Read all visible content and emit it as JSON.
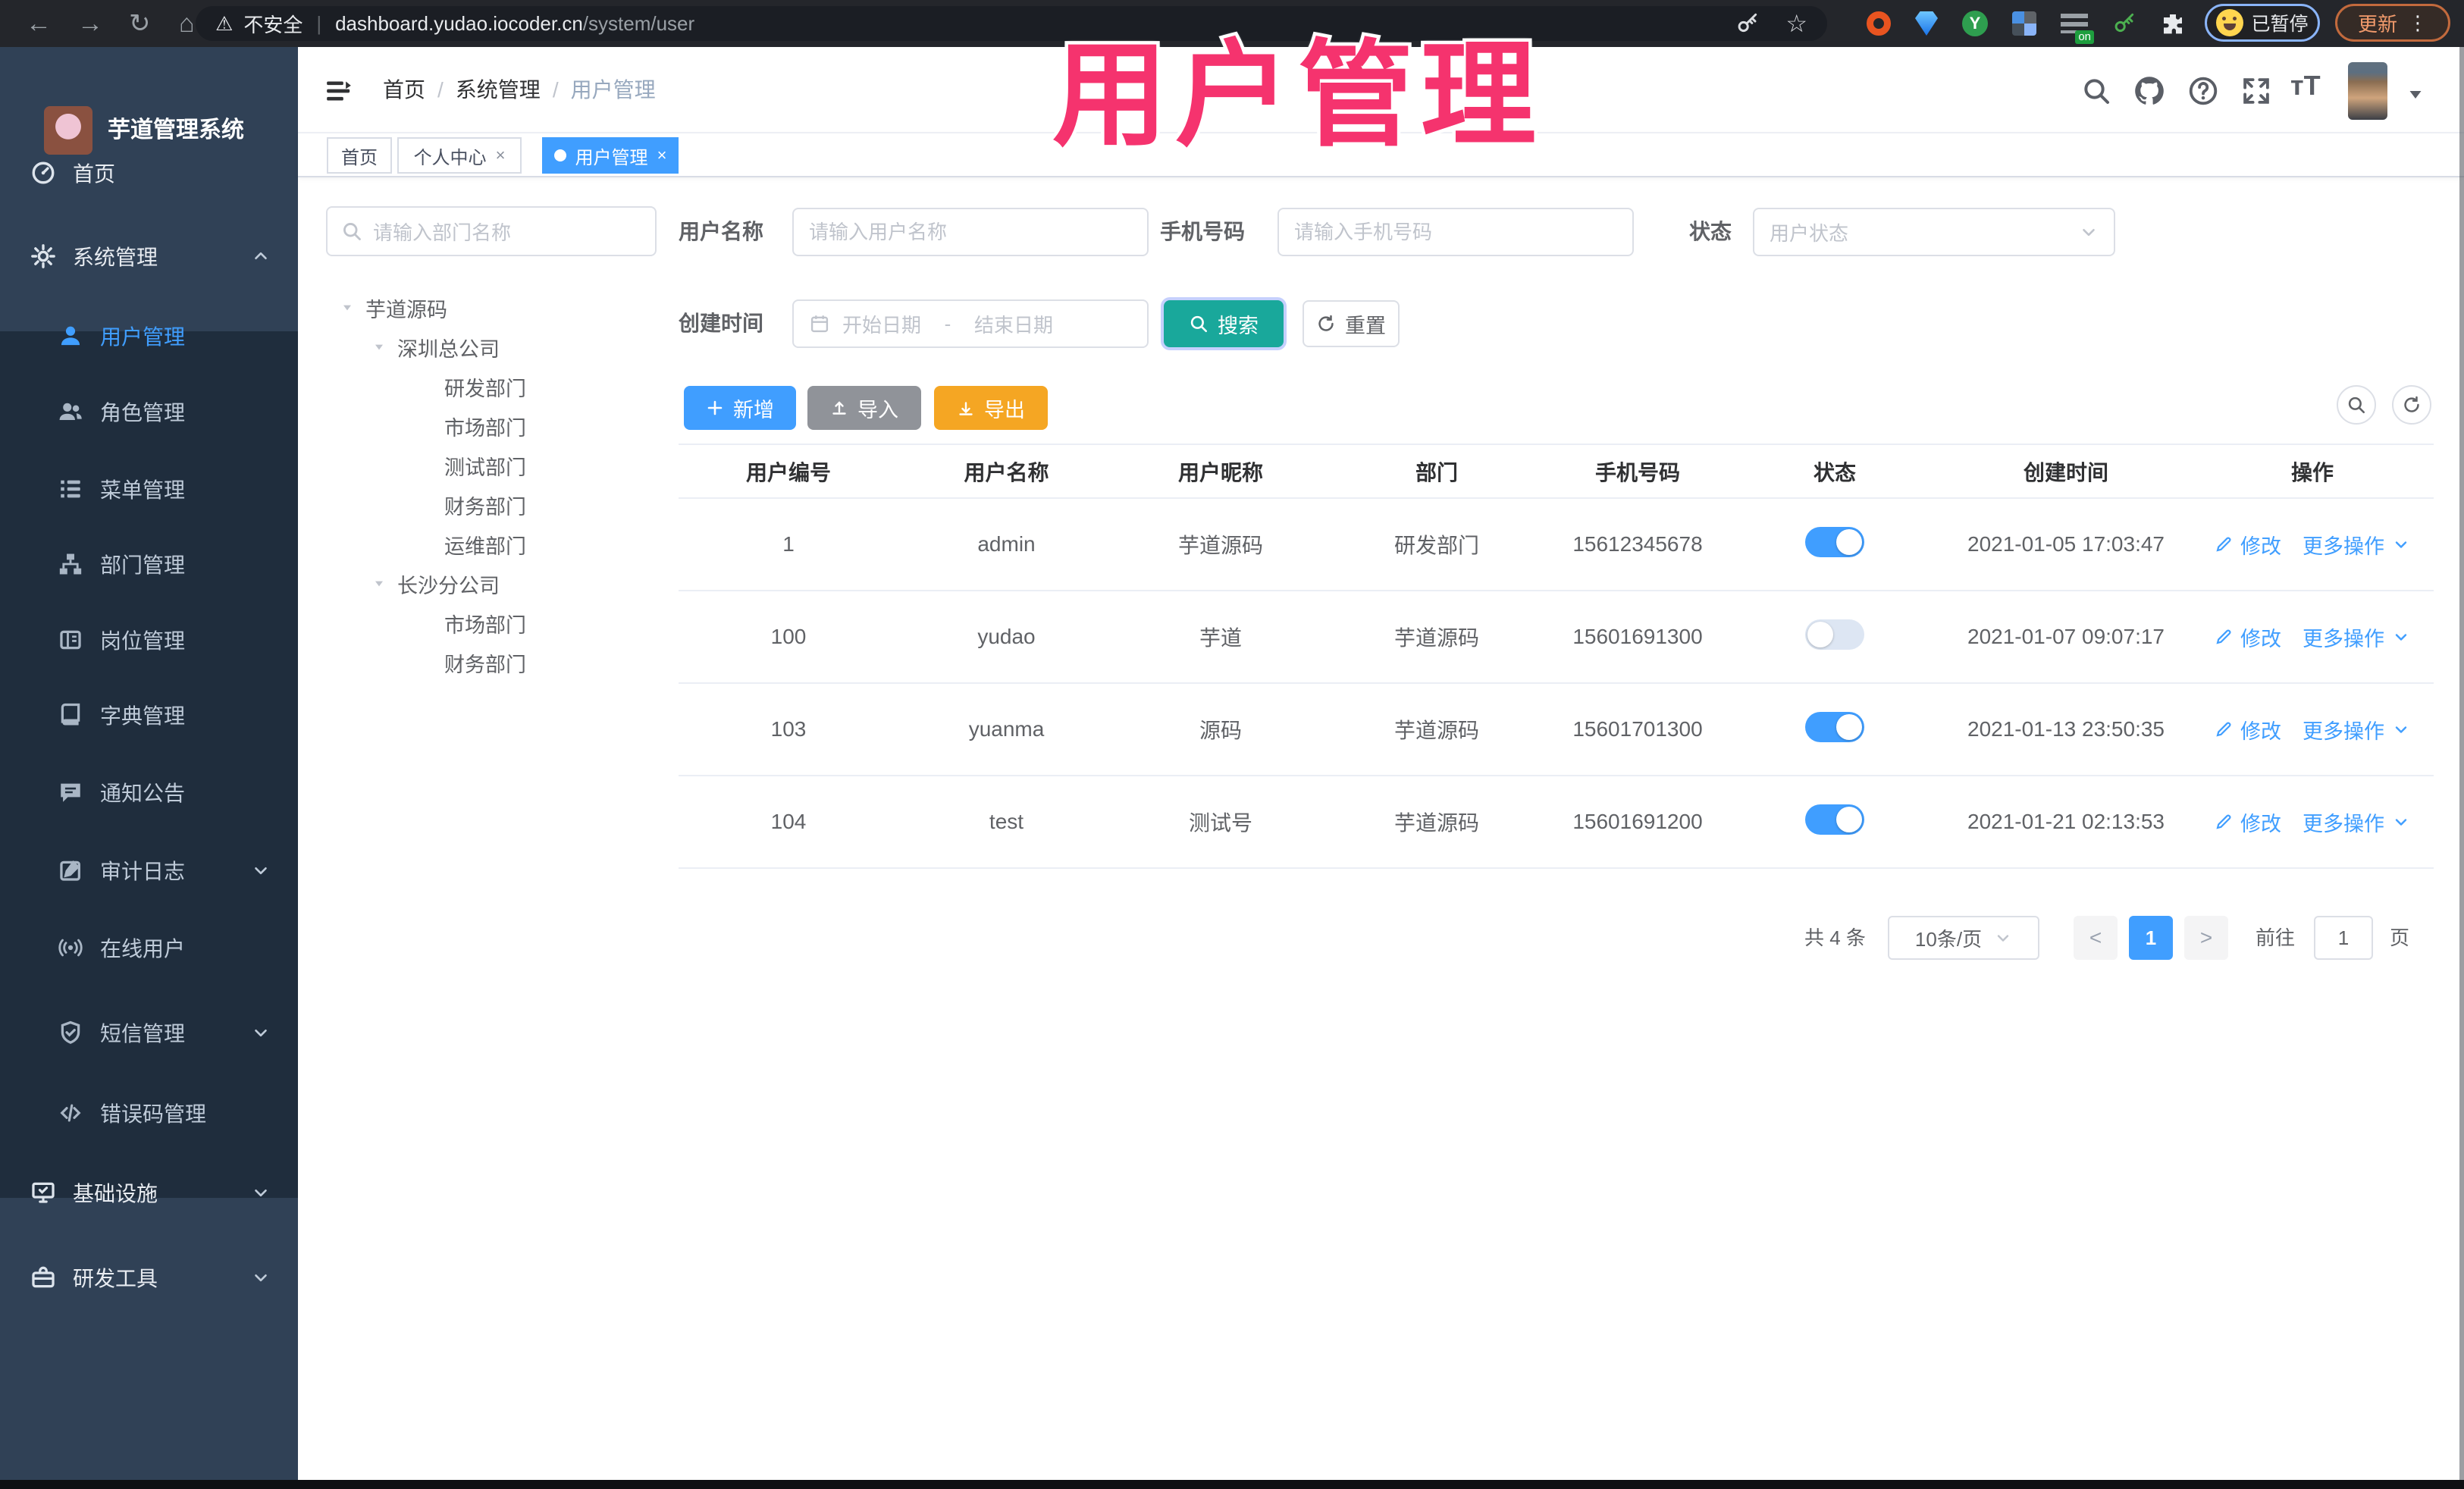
{
  "colors": {
    "accent": "#409EFF",
    "teal": "#19A89B",
    "warning": "#F5A623",
    "info": "#909399",
    "pink": "#F5336E",
    "sidebar": "#304156",
    "submenu": "#1f2d3d"
  },
  "icons": {
    "back": "←",
    "forward": "→",
    "reload": "↻",
    "home": "⌂",
    "star": "☆",
    "warning": "⚠",
    "pipe": "|",
    "more": "⋮",
    "ext_letter": "Y",
    "ext_on": "on",
    "caret_down": "▾",
    "close": "×",
    "prev": "<",
    "next": ">",
    "slash": "/"
  },
  "browser": {
    "security": "不安全",
    "host": "dashboard.yudao.iocoder.cn",
    "path": "/system/user",
    "profile_status": "已暂停",
    "update": "更新"
  },
  "overlay_title": "用户管理",
  "app_title": "芋道管理系统",
  "sidebar": {
    "items": [
      {
        "label": "首页"
      },
      {
        "label": "系统管理"
      },
      {
        "label": "用户管理"
      },
      {
        "label": "角色管理"
      },
      {
        "label": "菜单管理"
      },
      {
        "label": "部门管理"
      },
      {
        "label": "岗位管理"
      },
      {
        "label": "字典管理"
      },
      {
        "label": "通知公告"
      },
      {
        "label": "审计日志"
      },
      {
        "label": "在线用户"
      },
      {
        "label": "短信管理"
      },
      {
        "label": "错误码管理"
      },
      {
        "label": "基础设施"
      },
      {
        "label": "研发工具"
      }
    ]
  },
  "breadcrumb": [
    "首页",
    "系统管理",
    "用户管理"
  ],
  "tabs": [
    {
      "label": "首页"
    },
    {
      "label": "个人中心"
    },
    {
      "label": "用户管理"
    }
  ],
  "dept": {
    "placeholder": "请输入部门名称",
    "tree": [
      "芋道源码",
      "深圳总公司",
      "研发部门",
      "市场部门",
      "测试部门",
      "财务部门",
      "运维部门",
      "长沙分公司",
      "市场部门",
      "财务部门"
    ]
  },
  "filters": {
    "username_label": "用户名称",
    "username_ph": "请输入用户名称",
    "mobile_label": "手机号码",
    "mobile_ph": "请输入手机号码",
    "status_label": "状态",
    "status_ph": "用户状态",
    "time_label": "创建时间",
    "start_ph": "开始日期",
    "range_sep": "-",
    "end_ph": "结束日期",
    "search": "搜索",
    "reset": "重置"
  },
  "toolbar": {
    "add": "新增",
    "import": "导入",
    "export": "导出"
  },
  "table": {
    "columns": [
      "用户编号",
      "用户名称",
      "用户昵称",
      "部门",
      "手机号码",
      "状态",
      "创建时间",
      "操作"
    ],
    "ops": {
      "edit": "修改",
      "more": "更多操作"
    },
    "rows": [
      {
        "id": "1",
        "username": "admin",
        "nickname": "芋道源码",
        "dept": "研发部门",
        "mobile": "15612345678",
        "status": true,
        "created": "2021-01-05 17:03:47"
      },
      {
        "id": "100",
        "username": "yudao",
        "nickname": "芋道",
        "dept": "芋道源码",
        "mobile": "15601691300",
        "status": false,
        "created": "2021-01-07 09:07:17"
      },
      {
        "id": "103",
        "username": "yuanma",
        "nickname": "源码",
        "dept": "芋道源码",
        "mobile": "15601701300",
        "status": true,
        "created": "2021-01-13 23:50:35"
      },
      {
        "id": "104",
        "username": "test",
        "nickname": "测试号",
        "dept": "芋道源码",
        "mobile": "15601691200",
        "status": true,
        "created": "2021-01-21 02:13:53"
      }
    ]
  },
  "pagination": {
    "total": "共 4 条",
    "page_size": "10条/页",
    "page": "1",
    "goto": "前往",
    "goto_value": "1",
    "unit": "页"
  }
}
